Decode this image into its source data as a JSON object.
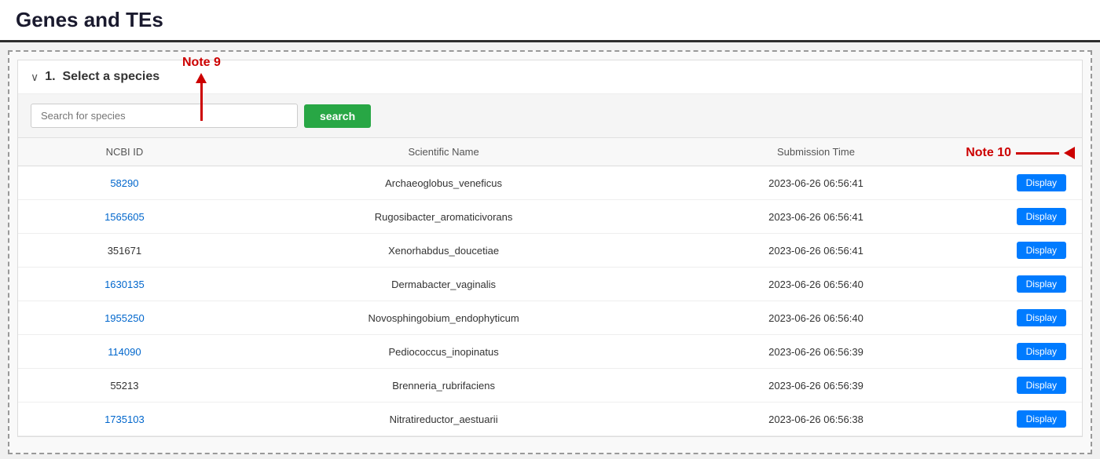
{
  "header": {
    "title": "Genes and TEs"
  },
  "section": {
    "number": "1.",
    "label": "Select a species",
    "chevron": "∨"
  },
  "search": {
    "placeholder": "Search for species",
    "button_label": "search"
  },
  "table": {
    "columns": [
      "NCBI ID",
      "Scientific Name",
      "Submission Time",
      ""
    ],
    "rows": [
      {
        "ncbi_id": "58290",
        "ncbi_link": true,
        "scientific_name": "Archaeoglobus_veneficus",
        "submission_time": "2023-06-26 06:56:41",
        "action": "Display"
      },
      {
        "ncbi_id": "1565605",
        "ncbi_link": true,
        "scientific_name": "Rugosibacter_aromaticivorans",
        "submission_time": "2023-06-26 06:56:41",
        "action": "Display"
      },
      {
        "ncbi_id": "351671",
        "ncbi_link": false,
        "scientific_name": "Xenorhabdus_doucetiae",
        "submission_time": "2023-06-26 06:56:41",
        "action": "Display"
      },
      {
        "ncbi_id": "1630135",
        "ncbi_link": true,
        "scientific_name": "Dermabacter_vaginalis",
        "submission_time": "2023-06-26 06:56:40",
        "action": "Display"
      },
      {
        "ncbi_id": "1955250",
        "ncbi_link": true,
        "scientific_name": "Novosphingobium_endophyticum",
        "submission_time": "2023-06-26 06:56:40",
        "action": "Display"
      },
      {
        "ncbi_id": "114090",
        "ncbi_link": true,
        "scientific_name": "Pediococcus_inopinatus",
        "submission_time": "2023-06-26 06:56:39",
        "action": "Display"
      },
      {
        "ncbi_id": "55213",
        "ncbi_link": false,
        "scientific_name": "Brenneria_rubrifaciens",
        "submission_time": "2023-06-26 06:56:39",
        "action": "Display"
      },
      {
        "ncbi_id": "1735103",
        "ncbi_link": true,
        "scientific_name": "Nitratireductor_aestuarii",
        "submission_time": "2023-06-26 06:56:38",
        "action": "Display"
      }
    ]
  },
  "annotations": {
    "note9_label": "Note 9",
    "note10_label": "Note 10"
  },
  "colors": {
    "accent_green": "#28a745",
    "accent_blue": "#007bff",
    "arrow_red": "#cc0000",
    "link_blue": "#0066cc",
    "header_dark": "#1a1a2e"
  }
}
